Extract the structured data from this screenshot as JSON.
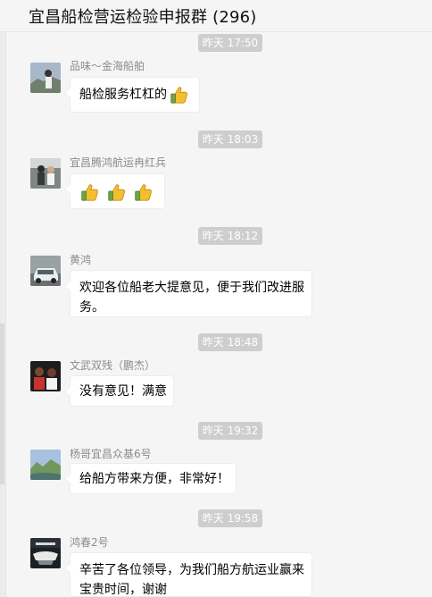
{
  "window": {
    "title": "宜昌船检营运检验申报群 (296)"
  },
  "icons": {
    "thumbs_up": "thumbs-up-icon"
  },
  "colors": {
    "background": "#f5f5f5",
    "bubble": "#ffffff",
    "timestamp_bg": "#cecece",
    "thumb_yellow": "#f3bf2f"
  },
  "messages": [
    {
      "time": "昨天 17:50",
      "sender": "品味～金海船舶",
      "text": "船检服务杠杠的"
    },
    {
      "time": "昨天 18:03",
      "sender": "宜昌腾鸿航运冉红兵",
      "text": ""
    },
    {
      "time": "昨天 18:12",
      "sender": "黄鸿",
      "text": "欢迎各位船老大提意见，便于我们改进服务。"
    },
    {
      "time": "昨天 18:48",
      "sender": "文武双残（鹏杰）",
      "text": "没有意见！满意"
    },
    {
      "time": "昨天 19:32",
      "sender": "杨哥宜昌众基6号",
      "text": "给船方带来方便，非常好！"
    },
    {
      "time": "昨天 19:58",
      "sender": "鸿春2号",
      "text": "辛苦了各位领导，为我们船方航运业赢来宝贵时间，谢谢"
    }
  ]
}
